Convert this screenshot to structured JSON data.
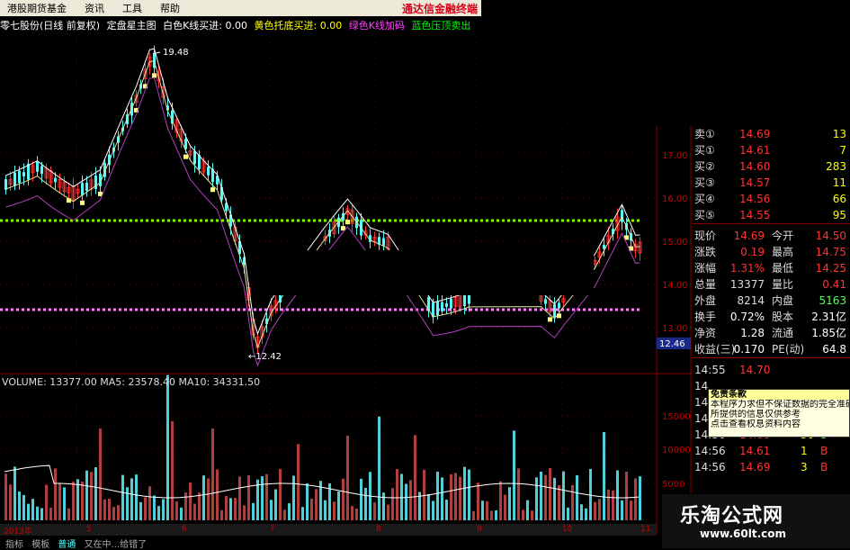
{
  "menu": {
    "items": [
      "港股期货基金",
      "资讯",
      "工具",
      "帮助"
    ],
    "brand": "通达信金融终端"
  },
  "header": {
    "stock": "零七股份(日线 前复权)",
    "indicator_name": "定盘星主图",
    "white_k": "白色K线买进: 0.00",
    "yellow_support": "黄色托底买进: 0.00",
    "green_k": "绿色K线加码",
    "green_top": "蓝色压顶卖出"
  },
  "chart_labels": {
    "high": "19.48",
    "low": "←12.42",
    "current_price_box": "12.46"
  },
  "y_axis": [
    "17.00",
    "16.00",
    "15.00",
    "14.00",
    "13.00"
  ],
  "volume": {
    "header": "VOLUME: 13377.00  MA5: 23578.40  MA10: 34331.50",
    "y_axis": [
      "15000",
      "10000",
      "5000"
    ]
  },
  "timeline": {
    "labels": [
      "2013年",
      "5",
      "6",
      "7",
      "8",
      "9",
      "10",
      "11"
    ]
  },
  "bottom_tabs": [
    "指标",
    "模板",
    "普通",
    "又在中...给错了"
  ],
  "panel": {
    "order_book": [
      {
        "label": "卖①",
        "price": "14.69",
        "vol": "13"
      },
      {
        "label": "买①",
        "price": "14.61",
        "vol": "7"
      },
      {
        "label": "买②",
        "price": "14.60",
        "vol": "283"
      },
      {
        "label": "买③",
        "price": "14.57",
        "vol": "11"
      },
      {
        "label": "买④",
        "price": "14.56",
        "vol": "66"
      },
      {
        "label": "买⑤",
        "price": "14.55",
        "vol": "95"
      }
    ],
    "stats": [
      {
        "l1": "现价",
        "v1": "14.69",
        "l2": "今开",
        "v2": "14.50"
      },
      {
        "l1": "涨跌",
        "v1": "0.19",
        "l2": "最高",
        "v2": "14.75"
      },
      {
        "l1": "涨幅",
        "v1": "1.31%",
        "l2": "最低",
        "v2": "14.25"
      },
      {
        "l1": "总量",
        "v1": "13377",
        "l2": "量比",
        "v2": "0.41"
      },
      {
        "l1": "外盘",
        "v1": "8214",
        "l2": "内盘",
        "v2": "5163"
      },
      {
        "l1": "换手",
        "v1": "0.72%",
        "l2": "股本",
        "v2": "2.31亿"
      },
      {
        "l1": "净资",
        "v1": "1.28",
        "l2": "流通",
        "v2": "1.85亿"
      },
      {
        "l1": "收益(三)",
        "v1": "0.170",
        "l2": "PE(动)",
        "v2": "64.8"
      }
    ],
    "trades": [
      {
        "time": "14:55",
        "price": "14.70",
        "vol": "",
        "side": ""
      },
      {
        "time": "14",
        "price": "",
        "vol": "",
        "side": ""
      },
      {
        "time": "14",
        "price": "",
        "vol": "",
        "side": ""
      },
      {
        "time": "14",
        "price": "",
        "vol": "",
        "side": ""
      },
      {
        "time": "14:56",
        "price": "14.60",
        "vol": "30",
        "side": "S"
      },
      {
        "time": "14:56",
        "price": "14.61",
        "vol": "1",
        "side": "B"
      },
      {
        "time": "14:56",
        "price": "14.69",
        "vol": "3",
        "side": "B"
      }
    ],
    "day_label": "日线"
  },
  "tooltip": {
    "title": "免责条款",
    "lines": [
      "本程序力求但不保证数据的完全准确",
      "所提供的信息仅供参考",
      "点击查看权息资料内容"
    ]
  },
  "watermark": {
    "title": "乐淘公式网",
    "url": "www.60lt.com"
  },
  "colors": {
    "up": "#ff3232",
    "down": "#54fcfc",
    "support_line": "#7cfc00",
    "pink_line": "#ff80ff"
  }
}
